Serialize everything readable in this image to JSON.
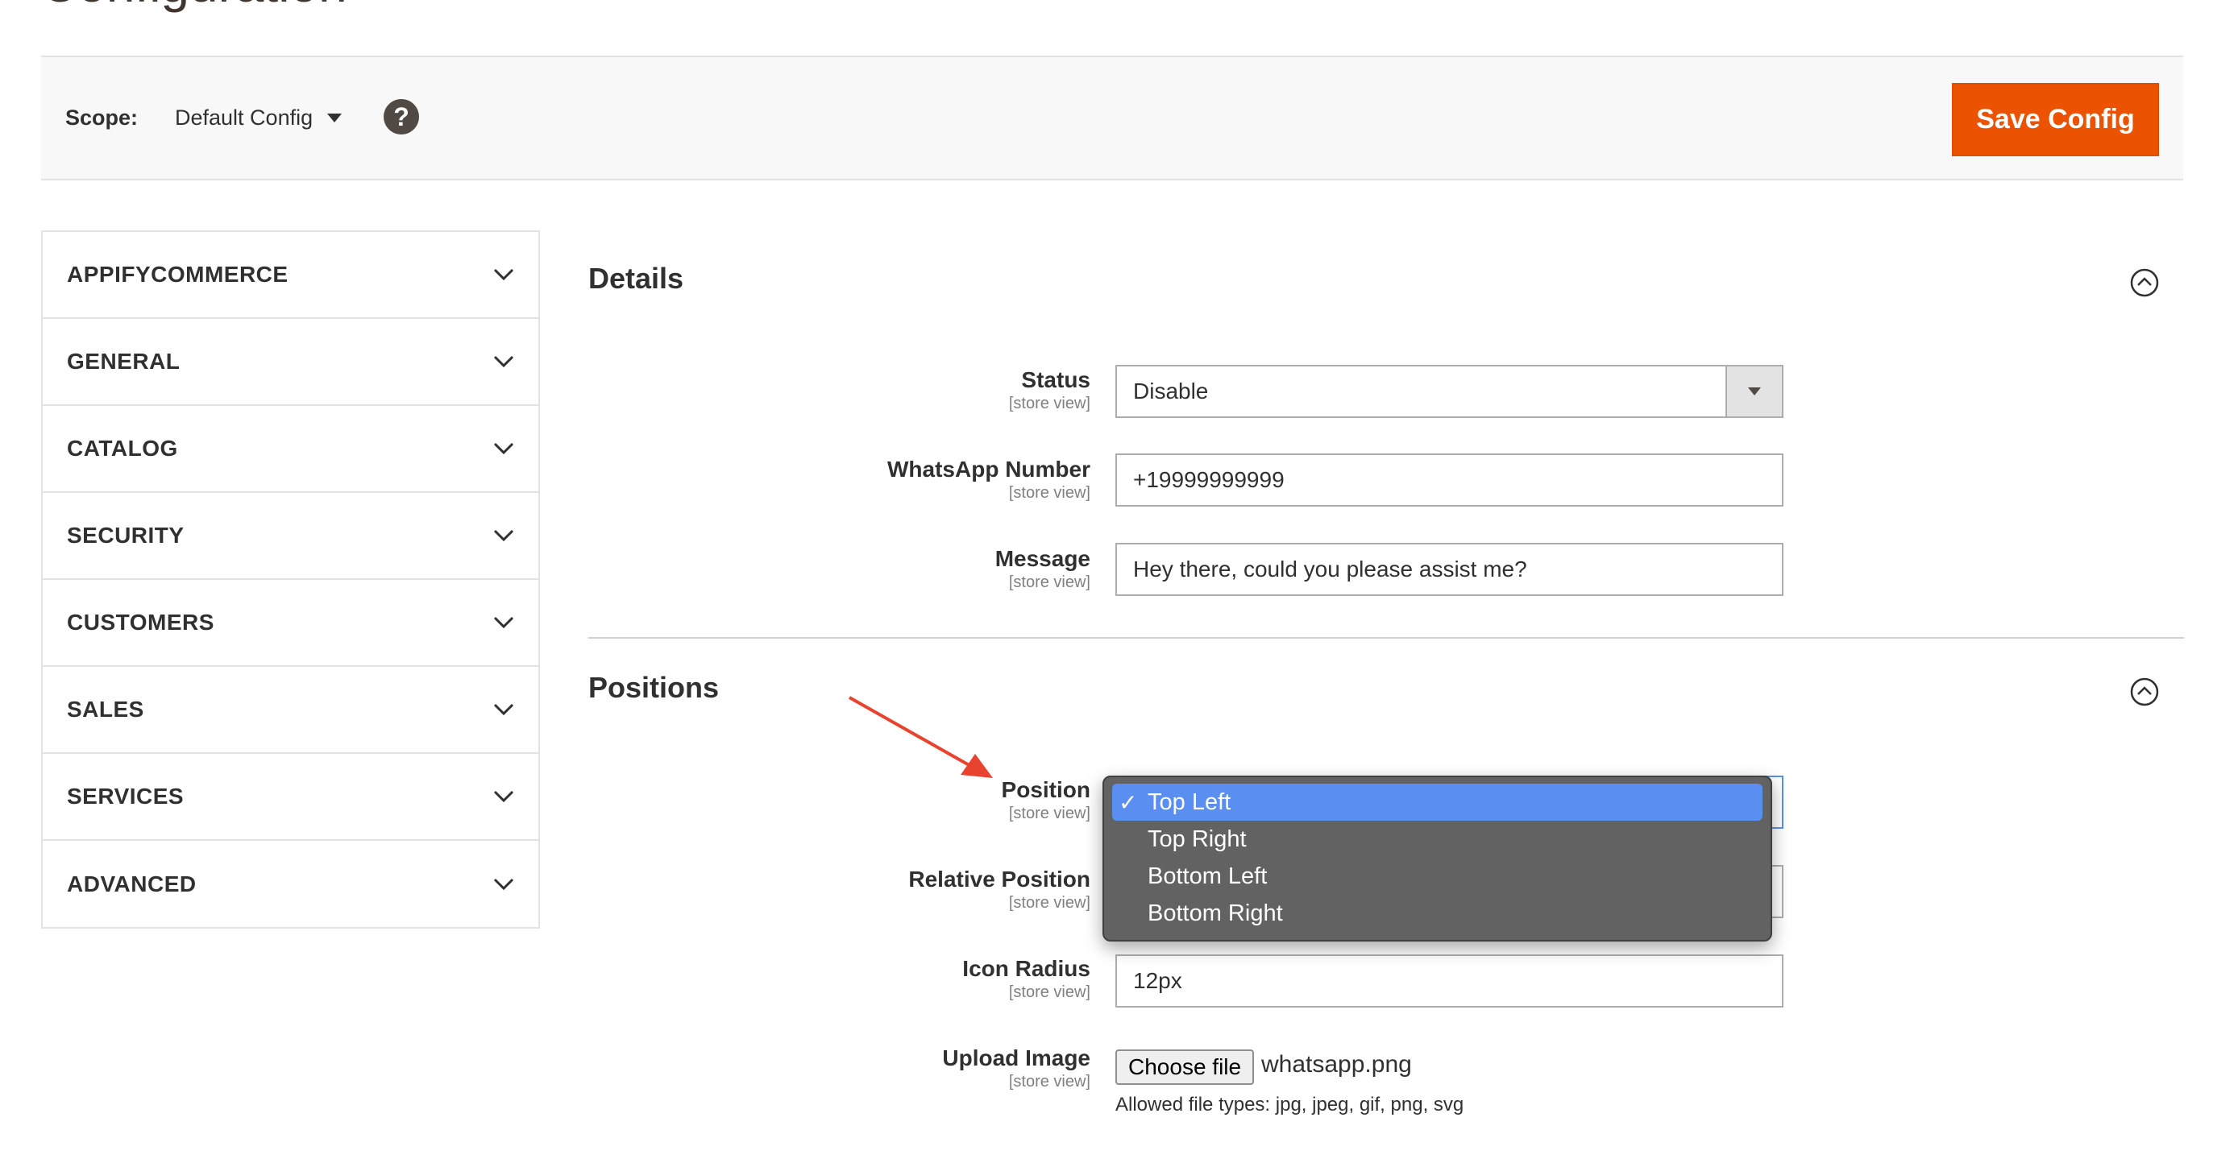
{
  "page": {
    "title": "Configuration"
  },
  "scope": {
    "label": "Scope:",
    "value": "Default Config",
    "help": "?"
  },
  "toolbar": {
    "save_label": "Save Config"
  },
  "sidebar": {
    "items": [
      {
        "label": "APPIFYCOMMERCE"
      },
      {
        "label": "GENERAL"
      },
      {
        "label": "CATALOG"
      },
      {
        "label": "SECURITY"
      },
      {
        "label": "CUSTOMERS"
      },
      {
        "label": "SALES"
      },
      {
        "label": "SERVICES"
      },
      {
        "label": "ADVANCED"
      }
    ]
  },
  "details": {
    "title": "Details",
    "fields": {
      "status": {
        "label": "Status",
        "scope": "[store view]",
        "value": "Disable"
      },
      "whatsapp": {
        "label": "WhatsApp Number",
        "scope": "[store view]",
        "value": "+19999999999"
      },
      "message": {
        "label": "Message",
        "scope": "[store view]",
        "value": "Hey there, could you please assist me?"
      }
    }
  },
  "positions": {
    "title": "Positions",
    "fields": {
      "position": {
        "label": "Position",
        "scope": "[store view]"
      },
      "relative": {
        "label": "Relative Position",
        "scope": "[store view]"
      },
      "radius": {
        "label": "Icon Radius",
        "scope": "[store view]",
        "value": "12px"
      },
      "upload": {
        "label": "Upload Image",
        "scope": "[store view]",
        "button": "Choose file",
        "file": "whatsapp.png",
        "allowed": "Allowed file types: jpg, jpeg, gif, png, svg"
      }
    },
    "dropdown": {
      "check": "✓",
      "options": [
        "Top Left",
        "Top Right",
        "Bottom Left",
        "Bottom Right"
      ],
      "selected": "Top Left"
    }
  },
  "colors": {
    "accent": "#eb5202",
    "selection": "#5a8ff1",
    "annotation_arrow": "#e8432e"
  },
  "icons": {
    "help": "help-icon",
    "collapse": "collapse-up-icon",
    "chevron": "chevron-down-icon",
    "select": "caret-down-icon",
    "check": "checkmark-icon",
    "arrow": "annotation-arrow-icon"
  }
}
